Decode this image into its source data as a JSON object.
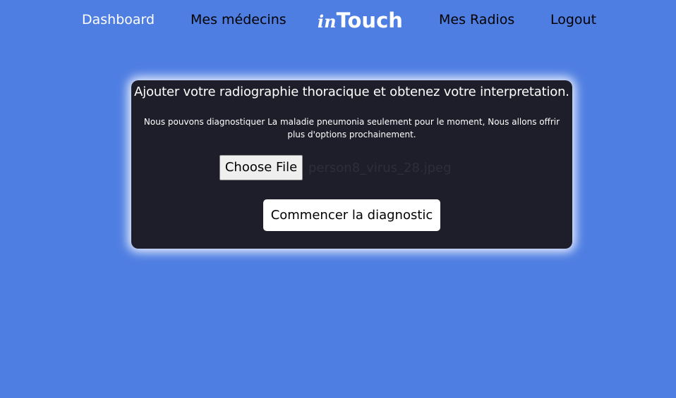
{
  "nav": {
    "dashboard": "Dashboard",
    "medecins": "Mes médecins",
    "radios": "Mes Radios",
    "logout": "Logout"
  },
  "logo": {
    "prefix": "in",
    "suffix": "Touch"
  },
  "upload": {
    "title": "Ajouter votre radiographie thoracique et obtenez votre interpretation.",
    "description": "Nous pouvons diagnostiquer La maladie pneumonia seulement pour le moment, Nous allons offrir plus d'options prochainement.",
    "choose_file_label": "Choose File",
    "selected_file": "person8_virus_28.jpeg",
    "submit_label": "Commencer la diagnostic"
  },
  "colors": {
    "background": "#4f7ee2",
    "card": "#1e1e2a",
    "active_nav": "#ffffff",
    "nav": "#000000"
  }
}
